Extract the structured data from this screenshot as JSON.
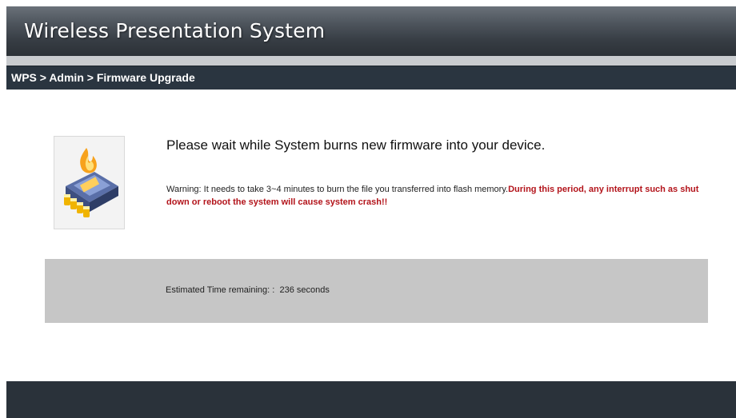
{
  "header": {
    "title": "Wireless Presentation System"
  },
  "breadcrumb": "WPS > Admin > Firmware Upgrade",
  "main": {
    "message": "Please wait while System burns new firmware into your device.",
    "warning_prefix": "Warning: It needs to take 3~4 minutes to burn the file you transferred into flash memory.",
    "warning_danger": "During this period, any interrupt such as shut down or reboot the system will cause system crash!!",
    "icon": "firmware-chip-icon"
  },
  "status": {
    "label": "Estimated Time remaining:",
    "separator": ":",
    "value": "236 seconds"
  },
  "colors": {
    "header_bg": "#4d545c",
    "breadcrumb_bg": "#2a3540",
    "panel_bg": "#c6c6c6",
    "danger": "#b3141b"
  }
}
